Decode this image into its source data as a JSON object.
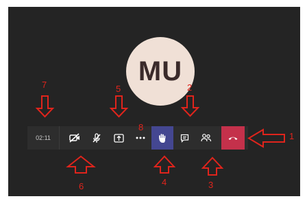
{
  "avatar": {
    "initials": "MU"
  },
  "toolbar": {
    "timer": "02:11",
    "buttons": [
      {
        "id": "camera",
        "icon": "camera-off-icon"
      },
      {
        "id": "microphone",
        "icon": "mic-off-icon"
      },
      {
        "id": "share",
        "icon": "share-screen-icon"
      },
      {
        "id": "more",
        "icon": "more-icon"
      },
      {
        "id": "raise-hand",
        "icon": "hand-icon"
      },
      {
        "id": "chat",
        "icon": "chat-icon"
      },
      {
        "id": "participants",
        "icon": "people-icon"
      },
      {
        "id": "hang-up",
        "icon": "phone-hangup-icon"
      }
    ],
    "colors": {
      "bar": "#2d2d2d",
      "hand_active": "#444791",
      "hangup": "#c4314b"
    }
  },
  "annotations": {
    "color": "#e0241c",
    "labels": {
      "a1": "1",
      "a2": "2",
      "a3": "3",
      "a4": "4",
      "a5": "5",
      "a6": "6",
      "a7": "7",
      "a8": "8"
    }
  }
}
